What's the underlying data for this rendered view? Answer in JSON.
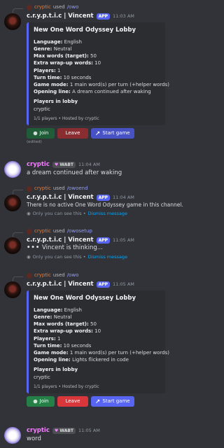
{
  "messages": [
    {
      "reply_user": "cryptic",
      "reply_verb": "used",
      "reply_cmd": "/owo",
      "author": "c.r.y.p.t.i.c | Vincent",
      "tag": "APP",
      "time": "11:03 AM",
      "embed": {
        "title": "New One Word Odyssey Lobby",
        "fields": [
          {
            "k": "Language:",
            "v": " English"
          },
          {
            "k": "Genre:",
            "v": " Neutral"
          },
          {
            "k": "Max words (target):",
            "v": " 50"
          },
          {
            "k": "Extra wrap-up words:",
            "v": " 10"
          },
          {
            "k": "Players:",
            "v": " 1"
          },
          {
            "k": "Turn time:",
            "v": " 10 seconds"
          },
          {
            "k": "Game mode:",
            "v": " 1 main word(s) per turn (+helper words)"
          },
          {
            "k": "Opening line:",
            "v": " A dream continued after waking"
          }
        ],
        "lobby_label": "Players in lobby",
        "lobby_value": "cryptic",
        "footer": "1/1 players • Hosted by cryptic"
      },
      "buttons": {
        "join": "Join",
        "leave": "Leave",
        "start": "Start game"
      },
      "edited": "(edited)"
    },
    {
      "author": "cryptic",
      "tag": "WABT",
      "time": "11:04 AM",
      "text": "a dream continued after waking"
    },
    {
      "reply_user": "cryptic",
      "reply_verb": "used",
      "reply_cmd": "/owoend",
      "author": "c.r.y.p.t.i.c | Vincent",
      "tag": "APP",
      "time": "11:04 AM",
      "text": "There is no active One Word Odyssey game in this channel.",
      "ephemeral": "Only you can see this •",
      "dismiss": "Dismiss message"
    },
    {
      "reply_user": "cryptic",
      "reply_verb": "used",
      "reply_cmd": "/owosetup",
      "author": "c.r.y.p.t.i.c | Vincent",
      "tag": "APP",
      "time": "11:05 AM",
      "text": "Vincent is thinking...",
      "ephemeral": "Only you can see this •",
      "dismiss": "Dismiss message"
    },
    {
      "reply_user": "cryptic",
      "reply_verb": "used",
      "reply_cmd": "/owo",
      "author": "c.r.y.p.t.i.c | Vincent",
      "tag": "APP",
      "time": "11:05 AM",
      "embed": {
        "title": "New One Word Odyssey Lobby",
        "fields": [
          {
            "k": "Language:",
            "v": " English"
          },
          {
            "k": "Genre:",
            "v": " Neutral"
          },
          {
            "k": "Max words (target):",
            "v": " 50"
          },
          {
            "k": "Extra wrap-up words:",
            "v": " 10"
          },
          {
            "k": "Players:",
            "v": " 1"
          },
          {
            "k": "Turn time:",
            "v": " 10 seconds"
          },
          {
            "k": "Game mode:",
            "v": " 1 main word(s) per turn (+helper words)"
          },
          {
            "k": "Opening line:",
            "v": " Lights flickered in code"
          }
        ],
        "lobby_label": "Players in lobby",
        "lobby_value": "cryptic",
        "footer": "1/1 players • Hosted by cryptic"
      },
      "buttons": {
        "join": "Join",
        "leave": "Leave",
        "start": "Start game"
      }
    },
    {
      "author": "cryptic",
      "tag": "WABT",
      "time": "11:05 AM",
      "text": "word"
    }
  ],
  "colors": {
    "accent": "#5865f2",
    "join": "#248046",
    "leave": "#da373c",
    "background": "#313338"
  }
}
